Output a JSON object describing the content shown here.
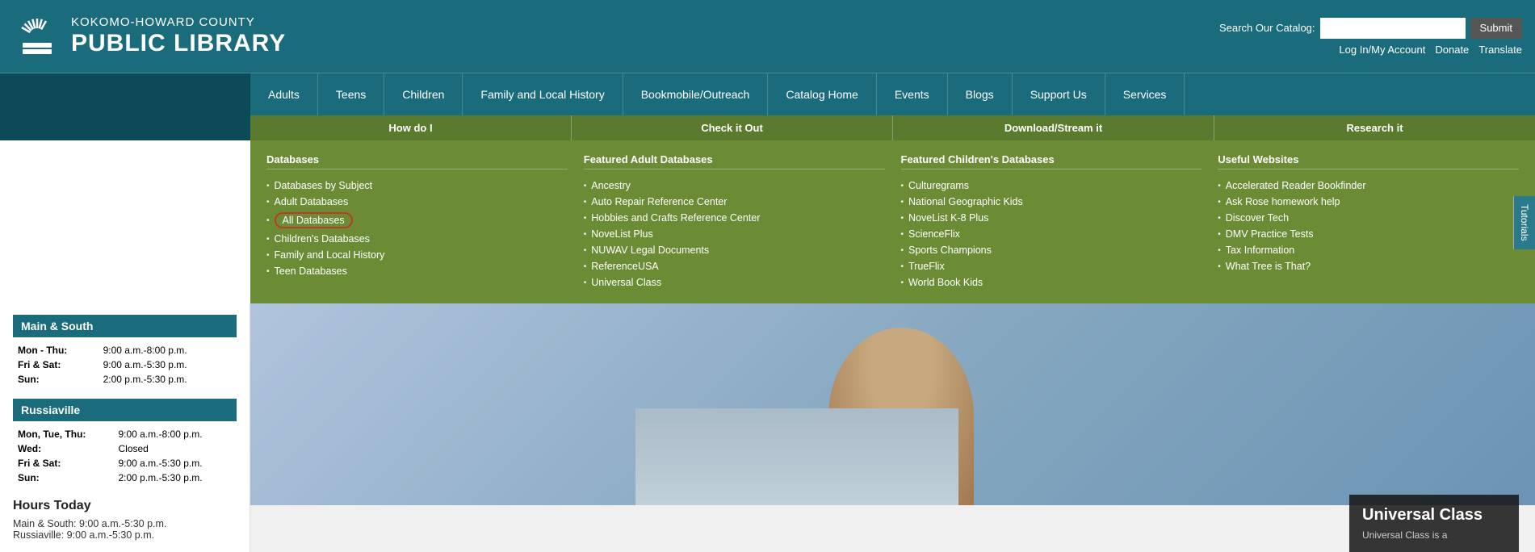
{
  "header": {
    "library_name_top": "KOKOMO-HOWARD COUNTY",
    "library_name_bottom": "PUBLIC LIBRARY",
    "search_label": "Search Our Catalog:",
    "search_placeholder": "",
    "submit_label": "Submit",
    "login_label": "Log In/My Account",
    "donate_label": "Donate",
    "translate_label": "Translate"
  },
  "main_nav": {
    "sidebar_label": "",
    "items": [
      {
        "label": "Adults"
      },
      {
        "label": "Teens"
      },
      {
        "label": "Children"
      },
      {
        "label": "Family and Local History"
      },
      {
        "label": "Bookmobile/Outreach"
      },
      {
        "label": "Catalog Home"
      },
      {
        "label": "Events"
      },
      {
        "label": "Blogs"
      },
      {
        "label": "Support Us"
      },
      {
        "label": "Services"
      }
    ]
  },
  "sub_nav": {
    "items": [
      {
        "label": "How do I"
      },
      {
        "label": "Check it Out"
      },
      {
        "label": "Download/Stream it"
      },
      {
        "label": "Research it"
      }
    ]
  },
  "dropdown": {
    "columns": [
      {
        "title": "Databases",
        "items": [
          "Databases by Subject",
          "Adult Databases",
          "All Databases",
          "Children's Databases",
          "Family and Local History",
          "Teen Databases"
        ],
        "highlighted": "All Databases"
      },
      {
        "title": "Featured Adult Databases",
        "items": [
          "Ancestry",
          "Auto Repair Reference Center",
          "Hobbies and Crafts Reference Center",
          "NoveList Plus",
          "NUWAV Legal Documents",
          "ReferenceUSA",
          "Universal Class"
        ]
      },
      {
        "title": "Featured Children's Databases",
        "items": [
          "Culturegrams",
          "National Geographic Kids",
          "NoveList K-8 Plus",
          "ScienceFlix",
          "Sports Champions",
          "TrueFlix",
          "World Book Kids"
        ]
      },
      {
        "title": "Useful Websites",
        "items": [
          "Accelerated Reader Bookfinder",
          "Ask Rose homework help",
          "Discover Tech",
          "DMV Practice Tests",
          "Tax Information",
          "What Tree is That?"
        ]
      }
    ]
  },
  "sidebar": {
    "main_south_title": "Main & South",
    "main_south_hours": [
      {
        "day": "Mon - Thu:",
        "hours": "9:00 a.m.-8:00 p.m."
      },
      {
        "day": "Fri & Sat:",
        "hours": "9:00 a.m.-5:30 p.m."
      },
      {
        "day": "Sun:",
        "hours": "2:00 p.m.-5:30 p.m."
      }
    ],
    "russiaville_title": "Russiaville",
    "russiaville_hours": [
      {
        "day": "Mon, Tue, Thu:",
        "hours": "9:00 a.m.-8:00 p.m."
      },
      {
        "day": "Wed:",
        "hours": "Closed"
      },
      {
        "day": "Fri & Sat:",
        "hours": "9:00 a.m.-5:30 p.m."
      },
      {
        "day": "Sun:",
        "hours": "2:00 p.m.-5:30 p.m."
      }
    ],
    "hours_today_title": "Hours Today",
    "hours_today_main": "Main & South: 9:00 a.m.-5:30 p.m.",
    "hours_today_russiaville": "Russiaville: 9:00 a.m.-5:30 p.m."
  },
  "universal_class": {
    "title": "Universal Class",
    "description": "Universal Class is a"
  },
  "tutorials_tab": {
    "label": "Tutorials"
  }
}
